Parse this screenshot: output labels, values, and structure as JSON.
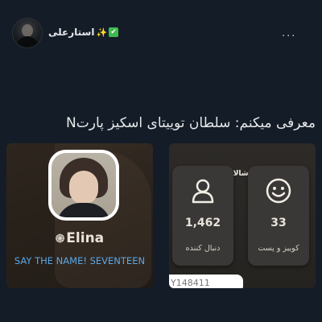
{
  "user": {
    "display_name": "استارعلی",
    "sparkle_emoji": "✨",
    "check_emoji": "✔"
  },
  "header": {
    "more_label": "..."
  },
  "tweet": {
    "text": "معرفی میکنم: سلطان توییتای اسکیز پارتN"
  },
  "media_left": {
    "name_prefix": "֎",
    "name": "Elina",
    "bio": "SAY THE NAME! SEVENTEEN"
  },
  "media_right": {
    "caption": "بگید ماشالا 😗🤝",
    "followers_value": "1,462",
    "followers_label": "دنبال کننده",
    "posts_value": "33",
    "posts_label": "کوییز و پست",
    "id_text": "Y148411"
  },
  "icons": {
    "followers": "person-icon",
    "posts": "smiley-icon",
    "more": "more-options-icon"
  },
  "colors": {
    "background": "#141c27",
    "bio_blue": "#5aa7e6",
    "check_green": "#3fb950"
  }
}
